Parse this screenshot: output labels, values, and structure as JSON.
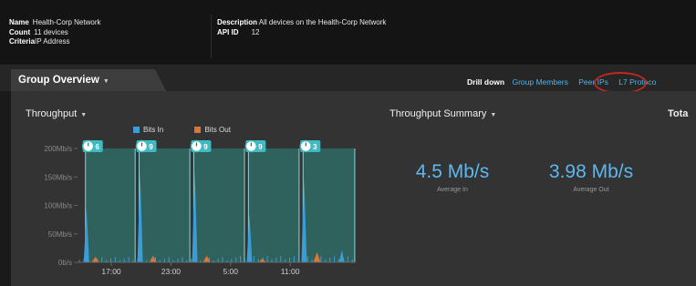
{
  "info": {
    "name_label": "Name",
    "name_value": "Health-Corp Network",
    "count_label": "Count",
    "count_value": "11 devices",
    "criteria_label": "Criteria",
    "criteria_value": "IP Address",
    "description_label": "Description",
    "description_value": "All devices on the Health-Corp Network",
    "apiid_label": "API ID",
    "apiid_value": "12"
  },
  "tabbar": {
    "tab_label": "Group Overview",
    "drill_label": "Drill down",
    "links": [
      "Group Members",
      "Peer IPs",
      "L7 Protoco"
    ]
  },
  "panels": {
    "throughput_title": "Throughput",
    "summary_title": "Throughput Summary",
    "total_title": "Tota"
  },
  "chart_data": {
    "type": "area",
    "legend": [
      {
        "name": "Bits In",
        "color": "#3a9dd8"
      },
      {
        "name": "Bits Out",
        "color": "#d9743a"
      }
    ],
    "yticks": [
      "200Mb/s",
      "150Mb/s",
      "100Mb/s",
      "50Mb/s",
      "0b/s"
    ],
    "ylim": [
      0,
      200
    ],
    "xticks": [
      "17:00",
      "23:00",
      "5:00",
      "11:00"
    ],
    "x_hours": [
      17,
      23,
      29,
      35
    ],
    "xlim": [
      13.6,
      41.6
    ],
    "activity_windows": [
      {
        "start": 14.4,
        "end": 19.4,
        "count": "6"
      },
      {
        "start": 19.8,
        "end": 24.9,
        "count": "9"
      },
      {
        "start": 25.3,
        "end": 30.4,
        "count": "9"
      },
      {
        "start": 30.8,
        "end": 35.9,
        "count": "9"
      },
      {
        "start": 36.3,
        "end": 41.5,
        "count": "3"
      }
    ],
    "series": [
      {
        "name": "Bits In",
        "spikes": [
          [
            14.5,
            95
          ],
          [
            19.9,
            160
          ],
          [
            25.4,
            160
          ],
          [
            30.9,
            85
          ],
          [
            36.4,
            148
          ],
          [
            40.2,
            22
          ]
        ]
      },
      {
        "name": "Bits Out",
        "spikes": [
          [
            15.4,
            10
          ],
          [
            21.2,
            12
          ],
          [
            26.6,
            12
          ],
          [
            32.2,
            7
          ],
          [
            37.7,
            18
          ]
        ]
      }
    ]
  },
  "summary": {
    "in_value": "4.5 Mb/s",
    "in_label": "Average In",
    "out_value": "3.98 Mb/s",
    "out_label": "Average Out"
  },
  "colors": {
    "accent": "#4fb3ec",
    "bits_in": "#3a9dd8",
    "bits_out": "#d9743a",
    "window_fill": "#2f6b64",
    "marker_fill": "#3fb9c2",
    "highlight_ring": "#c0281e"
  }
}
